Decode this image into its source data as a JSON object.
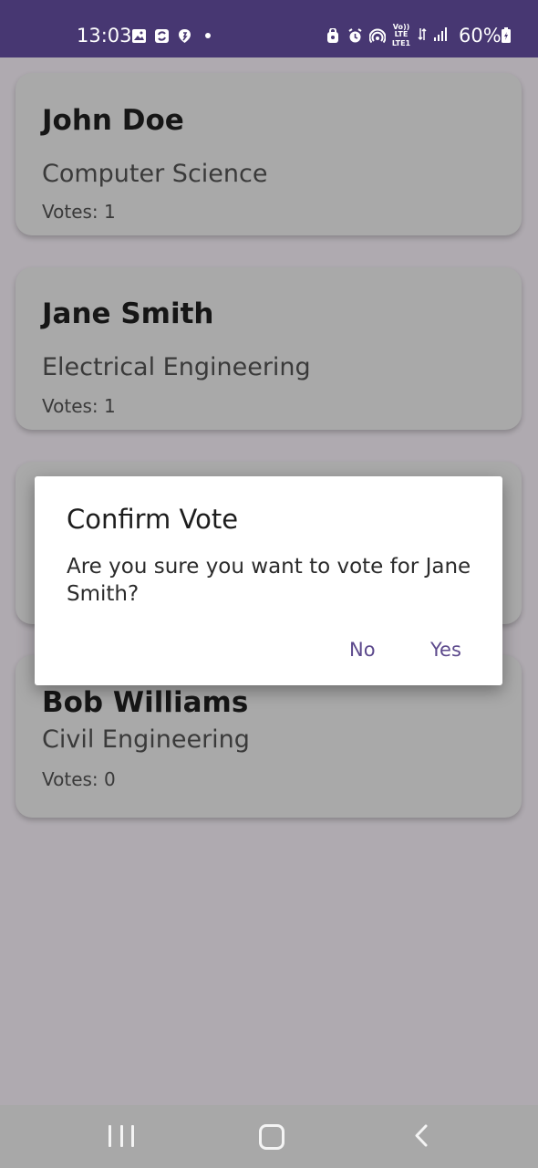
{
  "status_bar": {
    "time": "13:03",
    "battery": "60%",
    "network_label_top": "Vo)) LTE",
    "network_label_bottom": "LTE1",
    "left_icons": [
      "gallery-icon",
      "sync-icon",
      "app-icon",
      "dot-icon"
    ],
    "right_icons": [
      "lock-icon",
      "alarm-icon",
      "hotspot-icon",
      "volte-icon",
      "signal-icon",
      "battery-icon"
    ]
  },
  "candidates": [
    {
      "name": "John Doe",
      "department": "Computer Science",
      "votes": "Votes: 1"
    },
    {
      "name": "Jane Smith",
      "department": "Electrical Engineering",
      "votes": "Votes: 1"
    },
    {
      "name": "",
      "department": "",
      "votes": ""
    },
    {
      "name": "Bob Williams",
      "department": "Civil Engineering",
      "votes": "Votes: 0"
    }
  ],
  "dialog": {
    "title": "Confirm Vote",
    "message": "Are you sure you want to vote for Jane Smith?",
    "negative_label": "No",
    "positive_label": "Yes"
  },
  "nav_bar": {
    "icons": [
      "recents-icon",
      "home-icon",
      "back-icon"
    ]
  },
  "colors": {
    "status_bar": "#473772",
    "scrim_background": "#afaab0",
    "card": "#a9a9a9",
    "dialog_button": "#5d4a8d",
    "nav_bar": "#a8a8a8"
  }
}
